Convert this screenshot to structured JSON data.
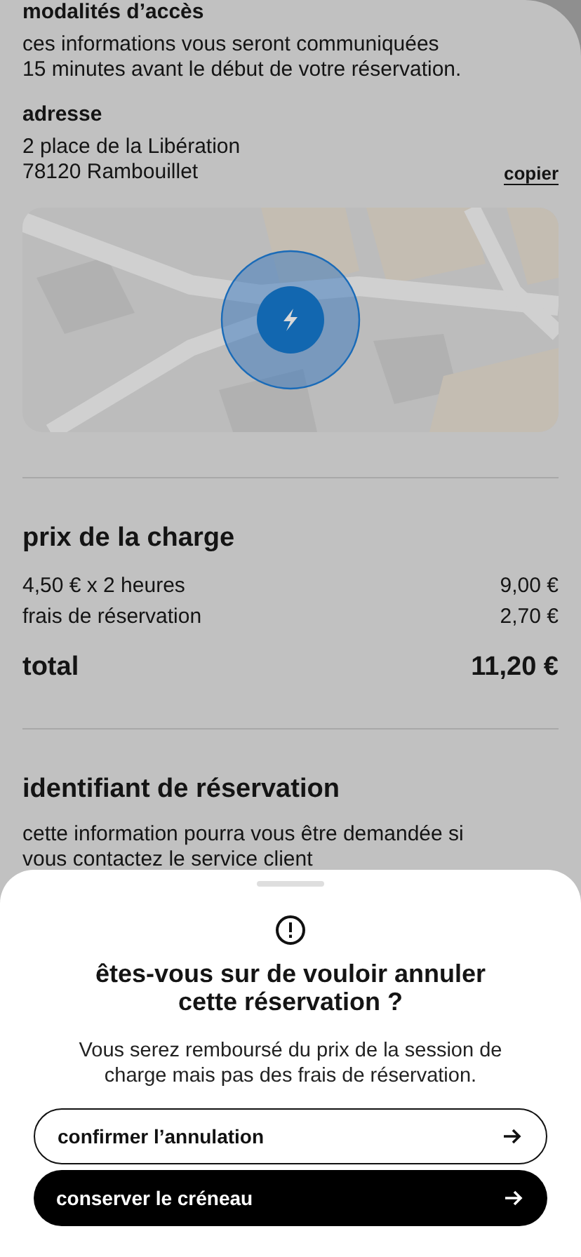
{
  "access": {
    "heading": "modalités d’accès",
    "text": "ces informations vous seront communiquées\n15 minutes avant le début de votre réservation."
  },
  "address": {
    "heading": "adresse",
    "text": "2 place de la Libération\n78120 Rambouillet",
    "copy_link": "copier"
  },
  "price": {
    "heading": "prix de la charge",
    "rows": [
      {
        "label": "4,50 € x 2 heures",
        "value": "9,00 €"
      },
      {
        "label": "frais de réservation",
        "value": "2,70 €"
      }
    ],
    "total_label": "total",
    "total_value": "11,20 €"
  },
  "booking_id": {
    "heading": "identifiant de réservation",
    "text": "cette information pourra vous être demandée si\nvous contactez le service client"
  },
  "sheet": {
    "title": "êtes-vous sur de vouloir annuler\ncette réservation ?",
    "text": "Vous serez remboursé du prix de la session de\ncharge mais pas des frais de réservation.",
    "buttons": [
      {
        "label": "confirmer l’annulation",
        "kind": "outline"
      },
      {
        "label": "conserver le créneau",
        "kind": "filled"
      }
    ]
  }
}
